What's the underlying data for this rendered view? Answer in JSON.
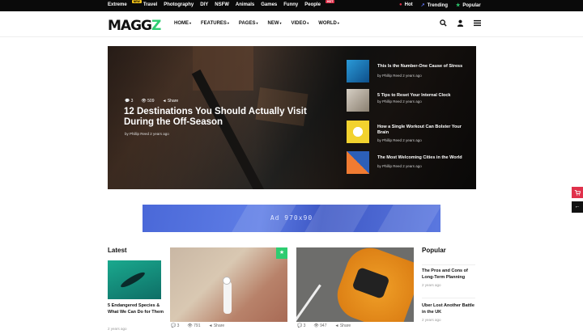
{
  "topbar": {
    "categories": [
      {
        "label": "Extreme",
        "badge": "NEW"
      },
      {
        "label": "Travel",
        "badge": ""
      },
      {
        "label": "Photography",
        "badge": ""
      },
      {
        "label": "DIY",
        "badge": ""
      },
      {
        "label": "NSFW",
        "badge": ""
      },
      {
        "label": "Animals",
        "badge": ""
      },
      {
        "label": "Games",
        "badge": ""
      },
      {
        "label": "Funny",
        "badge": ""
      },
      {
        "label": "People",
        "badge": "HOT"
      }
    ],
    "right": [
      {
        "icon": "flame-icon",
        "glyph": "●",
        "color": "#e0314b",
        "label": "Hot"
      },
      {
        "icon": "trending-icon",
        "glyph": "↗",
        "color": "#5b6ee6",
        "label": "Trending"
      },
      {
        "icon": "star-icon",
        "glyph": "★",
        "color": "#2ecc71",
        "label": "Popular"
      }
    ]
  },
  "header": {
    "logo_main": "MAGG",
    "logo_accent": "Z",
    "nav": [
      "HOME",
      "FEATURES",
      "PAGES",
      "NEW",
      "VIDEO",
      "WORLD"
    ],
    "icons": [
      "search-icon",
      "user-icon",
      "menu-icon"
    ]
  },
  "hero": {
    "comments": "3",
    "views": "509",
    "share": "Share",
    "title": "12 Destinations You Should Actually Visit During the Off-Season",
    "byline": "by Phillip Reed 2 years ago",
    "list": [
      {
        "title": "This Is the Number-One Cause of Stress",
        "byline": "by Phillip Reed 2 years ago",
        "color": "#2a9ad8"
      },
      {
        "title": "5 Tips to Reset Your Internal Clock",
        "byline": "by Phillip Reed 2 years ago",
        "color": "#c9c0b4"
      },
      {
        "title": "How a Single Workout Can Bolster Your Brain",
        "byline": "by Phillip Reed 2 years ago",
        "color": "#f2d22e"
      },
      {
        "title": "The Most Welcoming Cities in the World",
        "byline": "by Phillip Reed 2 years ago",
        "color": "#f07b32"
      }
    ]
  },
  "ad": {
    "label": "Ad 970x90"
  },
  "latest": {
    "heading": "Latest",
    "title": "5 Endangered Species & What We Can Do for Them",
    "date": "2 years ago"
  },
  "cards": [
    {
      "comments": "3",
      "views": "791",
      "share": "Share"
    },
    {
      "comments": "3",
      "views": "947",
      "share": "Share"
    }
  ],
  "popular": {
    "heading": "Popular",
    "items": [
      {
        "title": "The Pros and Cons of Long-Term Planning",
        "date": "2 years ago"
      },
      {
        "title": "Uber Lost Another Battle in the UK",
        "date": "2 years ago"
      }
    ]
  },
  "side_buttons": [
    {
      "icon": "cart-icon",
      "glyph": "🛒",
      "color": "#e0314b"
    },
    {
      "icon": "arrow-left-icon",
      "glyph": "←",
      "color": "#111"
    }
  ]
}
